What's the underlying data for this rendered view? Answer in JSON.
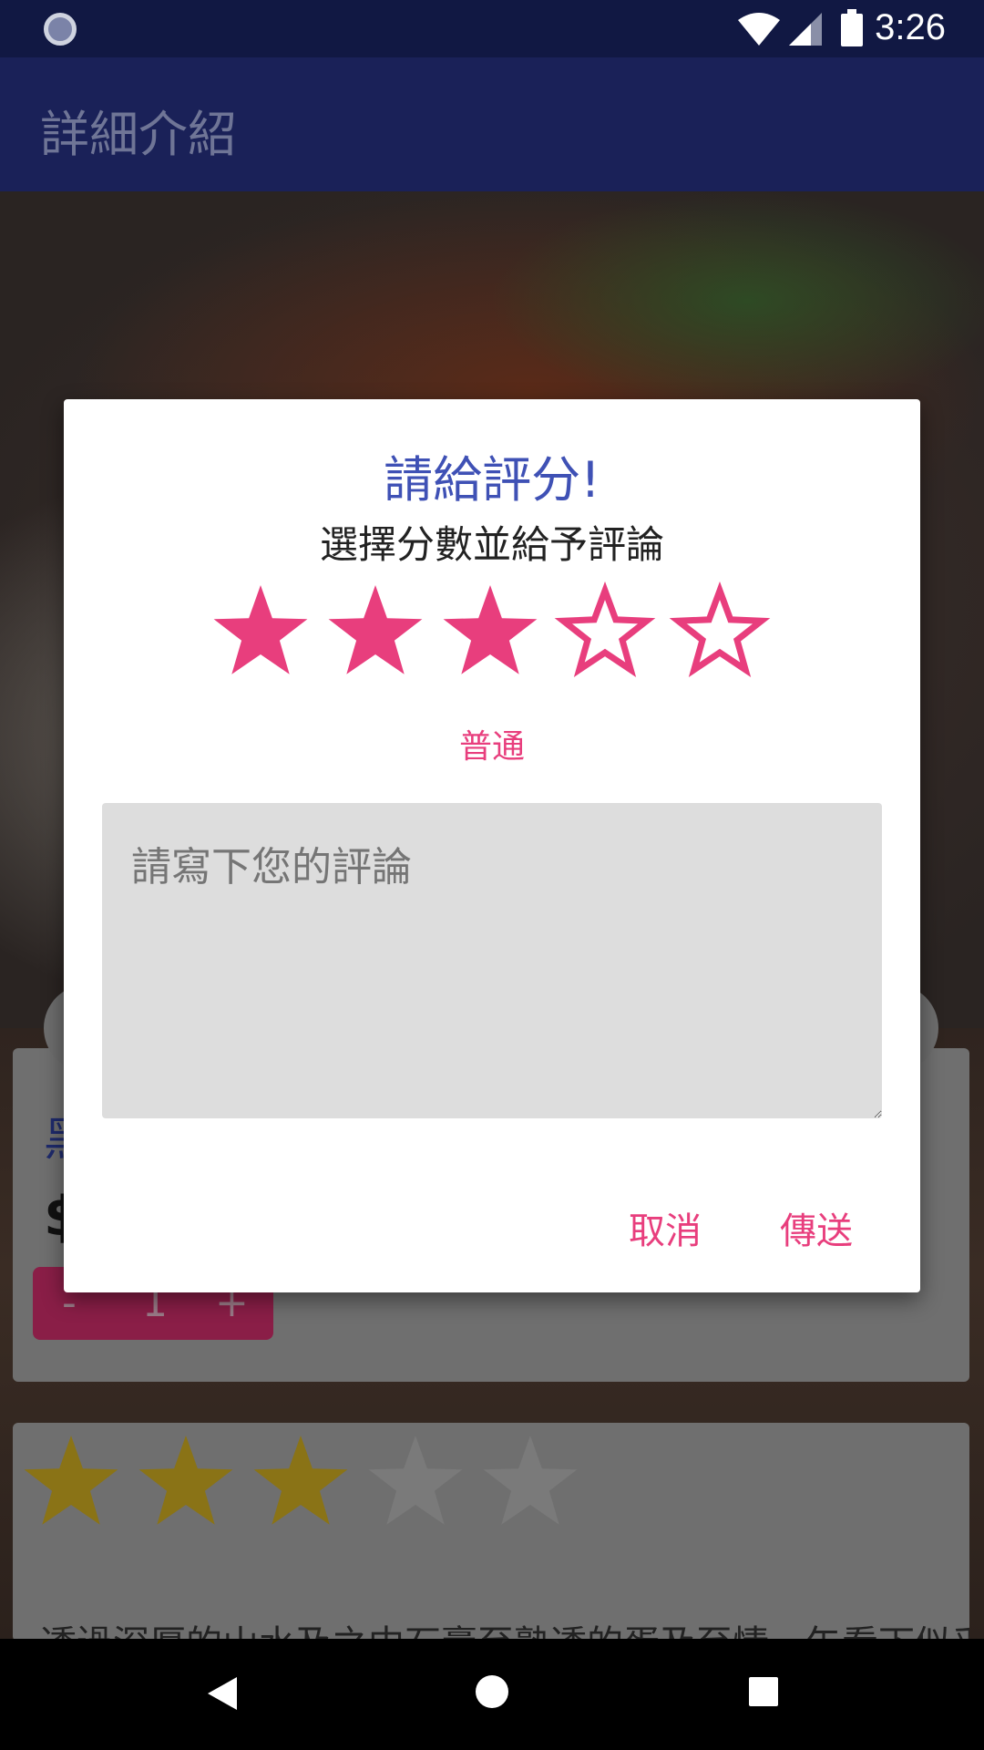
{
  "status_bar": {
    "time": "3:26"
  },
  "app_bar": {
    "title": "詳細介紹"
  },
  "background": {
    "item_name_partial": "黑",
    "price_partial": "$",
    "stepper": {
      "minus": "-",
      "qty": "1",
      "plus": "+"
    },
    "review_rating": 3,
    "review_rating_max": 5,
    "description_partial": "透過深厚的山水及之中石膏至熟透的蛋及至情，午看下似乎"
  },
  "dialog": {
    "title": "請給評分!",
    "subtitle": "選擇分數並給予評論",
    "rating": 3,
    "rating_max": 5,
    "rating_label": "普通",
    "comment_placeholder": "請寫下您的評論",
    "cancel_label": "取消",
    "send_label": "傳送",
    "accent_color": "#e83e7d",
    "title_color": "#3f51b5"
  }
}
